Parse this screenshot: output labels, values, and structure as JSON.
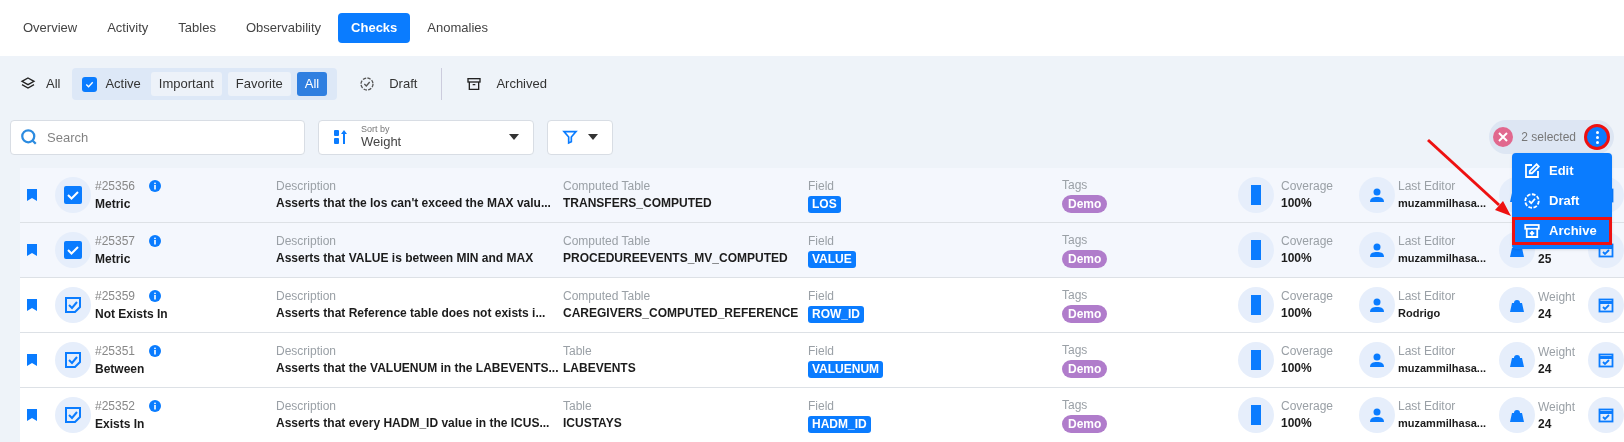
{
  "tabs": [
    {
      "label": "Overview",
      "selected": false
    },
    {
      "label": "Activity",
      "selected": false
    },
    {
      "label": "Tables",
      "selected": false
    },
    {
      "label": "Observability",
      "selected": false
    },
    {
      "label": "Checks",
      "selected": true
    },
    {
      "label": "Anomalies",
      "selected": false
    }
  ],
  "filters": {
    "all": {
      "label": "All"
    },
    "active": {
      "label": "Active",
      "checked": true
    },
    "subfilters": [
      {
        "label": "Important",
        "selected": false
      },
      {
        "label": "Favorite",
        "selected": false
      },
      {
        "label": "All",
        "selected": true
      }
    ],
    "draft": {
      "label": "Draft"
    },
    "archived": {
      "label": "Archived"
    }
  },
  "toolbar": {
    "search": {
      "placeholder": "Search"
    },
    "sort": {
      "label": "Sort by",
      "value": "Weight"
    },
    "selection": {
      "count": "2 selected"
    }
  },
  "menu": [
    {
      "label": "Edit",
      "kind": "edit",
      "highlighted": false
    },
    {
      "label": "Draft",
      "kind": "draft",
      "highlighted": false
    },
    {
      "label": "Archive",
      "kind": "archive",
      "highlighted": true
    }
  ],
  "rows": [
    {
      "selected": true,
      "id": "#25356",
      "type": "Metric",
      "desc_label": "Description",
      "description": "Asserts that the los can't exceed the MAX valu...",
      "table_label": "Computed Table",
      "table": "TRANSFERS_COMPUTED",
      "field_label": "Field",
      "field": "LOS",
      "tags_label": "Tags",
      "tag": "Demo",
      "coverage_label": "Coverage",
      "coverage": "100%",
      "editor_label": "Last Editor",
      "editor": "muzammilhasa..."
    },
    {
      "selected": true,
      "id": "#25357",
      "type": "Metric",
      "desc_label": "Description",
      "description": "Asserts that VALUE is between MIN and MAX",
      "table_label": "Computed Table",
      "table": "PROCEDUREEVENTS_MV_COMPUTED",
      "field_label": "Field",
      "field": "VALUE",
      "tags_label": "Tags",
      "tag": "Demo",
      "coverage_label": "Coverage",
      "coverage": "100%",
      "editor_label": "Last Editor",
      "editor": "muzammilhasa...",
      "weight": "25"
    },
    {
      "selected": false,
      "id": "#25359",
      "type": "Not Exists In",
      "desc_label": "Description",
      "description": "Asserts that Reference table does not exists i...",
      "table_label": "Computed Table",
      "table": "CAREGIVERS_COMPUTED_REFERENCE",
      "field_label": "Field",
      "field": "ROW_ID",
      "tags_label": "Tags",
      "tag": "Demo",
      "coverage_label": "Coverage",
      "coverage": "100%",
      "editor_label": "Last Editor",
      "editor": "Rodrigo",
      "weight_label": "Weight",
      "weight": "24"
    },
    {
      "selected": false,
      "id": "#25351",
      "type": "Between",
      "desc_label": "Description",
      "description": "Asserts that the VALUENUM in the LABEVENTS...",
      "table_label": "Table",
      "table": "LABEVENTS",
      "field_label": "Field",
      "field": "VALUENUM",
      "tags_label": "Tags",
      "tag": "Demo",
      "coverage_label": "Coverage",
      "coverage": "100%",
      "editor_label": "Last Editor",
      "editor": "muzammilhasa...",
      "weight_label": "Weight",
      "weight": "24"
    },
    {
      "selected": false,
      "id": "#25352",
      "type": "Exists In",
      "desc_label": "Description",
      "description": "Asserts that every HADM_ID value in the ICUS...",
      "table_label": "Table",
      "table": "ICUSTAYS",
      "field_label": "Field",
      "field": "HADM_ID",
      "tags_label": "Tags",
      "tag": "Demo",
      "coverage_label": "Coverage",
      "coverage": "100%",
      "editor_label": "Last Editor",
      "editor": "muzammilhasa...",
      "weight_label": "Weight",
      "weight": "24"
    }
  ]
}
